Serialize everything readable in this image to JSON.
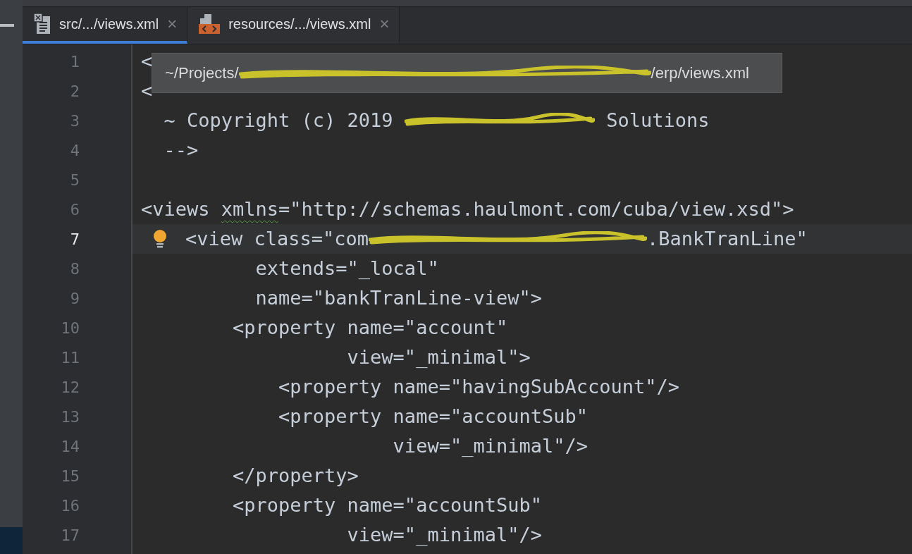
{
  "tabs": [
    {
      "label": "src/.../views.xml",
      "kind": "java",
      "selected": true,
      "close": "×"
    },
    {
      "label": "resources/.../views.xml",
      "kind": "xml",
      "selected": false,
      "close": "×"
    }
  ],
  "tooltip": {
    "parts": [
      {
        "text": "~/Projects/"
      },
      {
        "kind": "redaction"
      },
      {
        "text": "/erp/views.xml"
      }
    ]
  },
  "lines": [
    {
      "number": "1",
      "current": false,
      "parts": [
        {
          "text": "<"
        }
      ]
    },
    {
      "number": "2",
      "current": false,
      "parts": [
        {
          "text": "<"
        }
      ]
    },
    {
      "number": "3",
      "current": false,
      "parts": [
        {
          "text": "  ~ Copyright (c) 2019 "
        },
        {
          "kind": "redaction"
        },
        {
          "text": " Solutions"
        }
      ]
    },
    {
      "number": "4",
      "current": false,
      "parts": [
        {
          "text": "  -->"
        }
      ]
    },
    {
      "number": "5",
      "current": false
    },
    {
      "number": "6",
      "current": false,
      "parts": [
        {
          "text": "<views "
        },
        {
          "text": "xmlns",
          "typo": true
        },
        {
          "text": "=\"http://schemas.haulmont.com/cuba/view.xsd\">"
        }
      ]
    },
    {
      "number": "7",
      "current": true,
      "parts": [
        {
          "text": "<view class=\"com"
        },
        {
          "kind": "redaction"
        },
        {
          "text": ".BankTranLine\""
        }
      ]
    },
    {
      "number": "8",
      "current": false,
      "parts": [
        {
          "text": "          extends=\"_local\""
        }
      ]
    },
    {
      "number": "9",
      "current": false,
      "parts": [
        {
          "text": "          name=\"bankTranLine-view\">"
        }
      ]
    },
    {
      "number": "10",
      "current": false,
      "parts": [
        {
          "text": "        <property name=\"account\""
        }
      ]
    },
    {
      "number": "11",
      "current": false,
      "parts": [
        {
          "text": "                  view=\"_minimal\">"
        }
      ]
    },
    {
      "number": "12",
      "current": false,
      "parts": [
        {
          "text": "            <property name=\"havingSubAccount\"/>"
        }
      ]
    },
    {
      "number": "13",
      "current": false,
      "parts": [
        {
          "text": "            <property name=\"accountSub\""
        }
      ]
    },
    {
      "number": "14",
      "current": false,
      "parts": [
        {
          "text": "                      view=\"_minimal\"/>"
        }
      ]
    },
    {
      "number": "15",
      "current": false,
      "parts": [
        {
          "text": "        </property>"
        }
      ]
    },
    {
      "number": "16",
      "current": false,
      "parts": [
        {
          "text": "        <property name=\"accountSub\""
        }
      ]
    },
    {
      "number": "17",
      "current": false,
      "parts": [
        {
          "text": "                  view=\"_minimal\"/>"
        }
      ]
    }
  ]
}
